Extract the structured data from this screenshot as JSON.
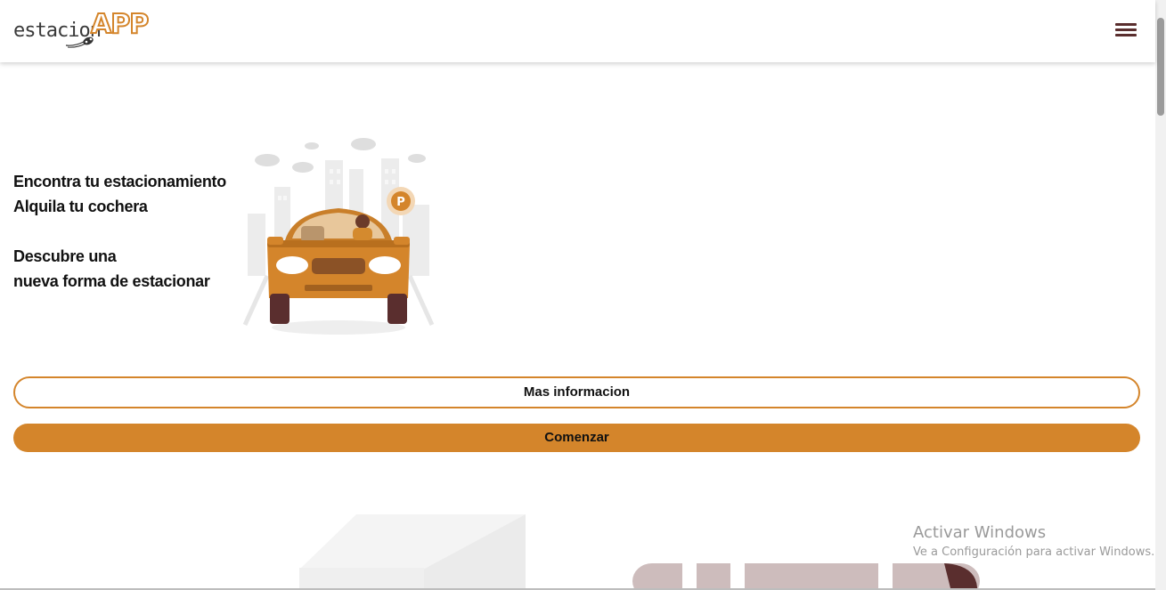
{
  "header": {
    "logo_text": "estacion",
    "logo_app": "APP",
    "menu_icon": "hamburger-menu-icon"
  },
  "hero": {
    "line1": "Encontra tu estacionamiento",
    "line2": "Alquila tu cochera",
    "line3": "Descubre una",
    "line4": "nueva forma de estacionar",
    "parking_badge": "P"
  },
  "buttons": {
    "more_info": "Mas informacion",
    "start": "Comenzar"
  },
  "watermark": {
    "title": "Activar Windows",
    "subtitle": "Ve a Configuración para activar Windows."
  },
  "colors": {
    "accent": "#d4852b",
    "menu": "#5a2e2e"
  }
}
